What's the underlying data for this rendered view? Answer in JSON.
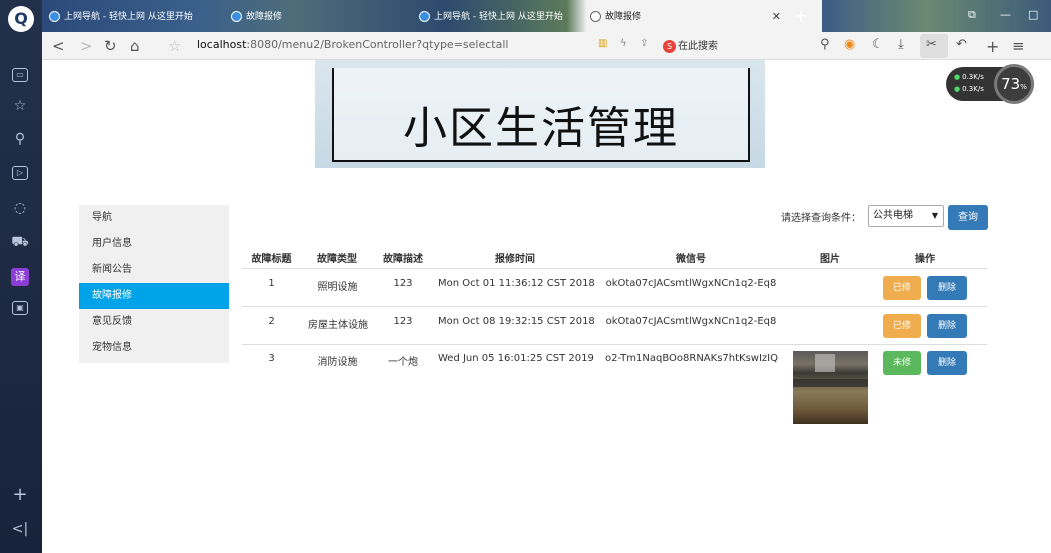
{
  "browser": {
    "tabs": [
      {
        "label": "上网导航 - 轻快上网 从这里开始"
      },
      {
        "label": "故障报修"
      },
      {
        "label": "上网导航 - 轻快上网 从这里开始"
      },
      {
        "label": "故障报修"
      }
    ],
    "url_prefix": "localhost",
    "url_rest": ":8080/menu2/BrokenController?qtype=selectall",
    "search_engine_label": "在此搜索",
    "speed_up": "0.3K/s",
    "speed_down": "0.3K/s",
    "speed_percent": "73",
    "speed_percent_unit": "%"
  },
  "banner": {
    "title": "小区生活管理"
  },
  "menu": {
    "items": [
      {
        "label": "导航"
      },
      {
        "label": "用户信息"
      },
      {
        "label": "新闻公告"
      },
      {
        "label": "故障报修"
      },
      {
        "label": "意见反馈"
      },
      {
        "label": "宠物信息"
      }
    ],
    "active_index": 3
  },
  "query": {
    "label": "请选择查询条件：",
    "selected": "公共电梯",
    "button": "查询"
  },
  "table": {
    "headers": [
      "故障标题",
      "故障类型",
      "故障描述",
      "报修时间",
      "微信号",
      "图片",
      "操作"
    ],
    "rows": [
      {
        "title": "1",
        "type": "照明设施",
        "desc": "123",
        "time": "Mon Oct 01 11:36:12 CST 2018",
        "wechat": "okOta07cJACsmtlWgxNCn1q2-Eq8",
        "status": "已修",
        "status_color": "#f0ad4e",
        "delete": "删除",
        "has_image": false
      },
      {
        "title": "2",
        "type": "房屋主体设施",
        "desc": "123",
        "time": "Mon Oct 08 19:32:15 CST 2018",
        "wechat": "okOta07cJACsmtlWgxNCn1q2-Eq8",
        "status": "已修",
        "status_color": "#f0ad4e",
        "delete": "删除",
        "has_image": false
      },
      {
        "title": "3",
        "type": "消防设施",
        "desc": "一个炮",
        "time": "Wed Jun 05 16:01:25 CST 2019",
        "wechat": "o2-Tm1NaqBOo8RNAKs7htKswIzIQ",
        "status": "未修",
        "status_color": "#5cb85c",
        "delete": "删除",
        "has_image": true
      }
    ]
  }
}
